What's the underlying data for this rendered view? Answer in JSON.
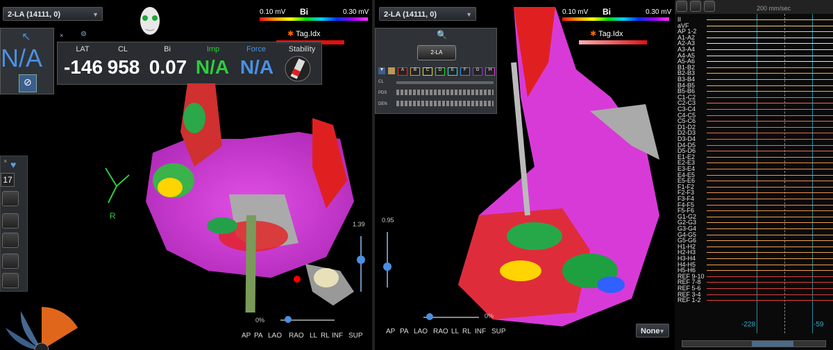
{
  "left_map": {
    "dropdown": "2-LA (14111, 0)",
    "bar_min": "0.10 mV",
    "bar_title": "Bi",
    "bar_max": "0.30 mV",
    "tag_label": "Tag.Idx",
    "na_label": "N/A",
    "slider_value": "1.39",
    "zoom_pct": "0%",
    "orient_label": "R",
    "counter": "17",
    "view_buttons": [
      "AP",
      "PA",
      "LAO",
      "RAO",
      "LL",
      "RL",
      "INF",
      "SUP"
    ]
  },
  "metrics": {
    "headers": [
      "LAT",
      "CL",
      "Bi",
      "Imp",
      "Force",
      "Stability"
    ],
    "values": [
      "-146",
      "958",
      "0.07",
      "N/A",
      "N/A"
    ],
    "colors": {
      "default": "#ffffff",
      "imp": "#2ecc40",
      "force": "#4a90e2"
    }
  },
  "right_map": {
    "dropdown": "2-LA (14111, 0)",
    "bar_min": "0.10 mV",
    "bar_title": "Bi",
    "bar_max": "0.30 mV",
    "tag_label": "Tag.Idx",
    "slider_value": "0.95",
    "zoom_pct": "0%",
    "layout_button": "2-LA",
    "letters": [
      "A",
      "B",
      "C",
      "D",
      "E",
      "F",
      "G",
      "H"
    ],
    "rows": [
      "CL",
      "PDS",
      "DEN"
    ],
    "none_select": "None",
    "view_buttons": [
      "AP",
      "PA",
      "LAO",
      "RAO",
      "LL",
      "RL",
      "INF",
      "SUP"
    ]
  },
  "ecg": {
    "speed": "200 mm/sec",
    "left_time": "-228",
    "right_time": "-59",
    "channels": [
      "II",
      "aVF",
      "AP 1-2",
      "A1-A2",
      "A2-A3",
      "A3-A4",
      "A4-A5",
      "A5-A6",
      "B1-B2",
      "B2-B3",
      "B3-B4",
      "B4-B5",
      "B5-B6",
      "C1-C2",
      "C2-C3",
      "C3-C4",
      "C4-C5",
      "C5-C6",
      "D1-D2",
      "D2-D3",
      "D3-D4",
      "D4-D5",
      "D5-D6",
      "E1-E2",
      "E2-E3",
      "E3-E4",
      "E4-E5",
      "E5-E6",
      "F1-F2",
      "F2-F3",
      "F3-F4",
      "F4-F5",
      "F5-F6",
      "G1-G2",
      "G2-G3",
      "G3-G4",
      "G4-G5",
      "G5-G6",
      "H1-H2",
      "H2-H3",
      "H3-H4",
      "H4-H5",
      "H5-H6",
      "REF 9-10",
      "REF 7-8",
      "REF 5-6",
      "REF 3-4",
      "REF 1-2"
    ]
  }
}
